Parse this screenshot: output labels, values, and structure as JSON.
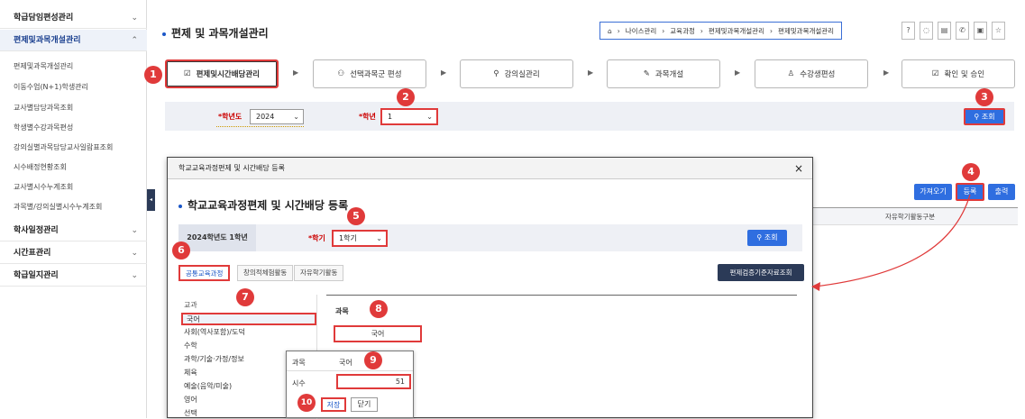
{
  "sidebar": {
    "groups": [
      {
        "label": "학급담임편성관리",
        "open": false
      },
      {
        "label": "편제및과목개설관리",
        "open": true,
        "items": [
          "편제및과목개설관리",
          "이동수업(N+1)학생관리",
          "교사별담당과목조회",
          "학생별수강과목편성",
          "강의실별과목담당교사일람표조회",
          "시수배정현황조회",
          "교사별시수누계조회",
          "과목별/강의실별시수누계조회"
        ]
      },
      {
        "label": "학사일정관리",
        "open": false
      },
      {
        "label": "시간표관리",
        "open": false
      },
      {
        "label": "학급일지관리",
        "open": false
      }
    ]
  },
  "page": {
    "title": "편제 및 과목개설관리",
    "breadcrumb": [
      "나이스관리",
      "교육과정",
      "편제및과목개설관리",
      "편제및과목개설관리"
    ]
  },
  "steps": [
    "편제및시간배당관리",
    "선택과목군 편성",
    "강의실관리",
    "과목개설",
    "수강생편성",
    "확인 및 승인"
  ],
  "filter": {
    "year_label": "*학년도",
    "year": "2024",
    "grade_label": "*학년",
    "grade": "1",
    "search": "조회"
  },
  "actions": {
    "fetch": "가져오기",
    "register": "등록",
    "print": "출력"
  },
  "table": {
    "col": "자유학기활동구분"
  },
  "modal": {
    "header": "학교교육과정편제 및 시간배당 등록",
    "title": "학교교육과정편제 및 시간배당 등록",
    "info": "2024학년도 1학년",
    "term_label": "*학기",
    "term": "1학기",
    "search": "조회",
    "tabs": [
      "공통교육과정",
      "창의적체험활동",
      "자유학기활동"
    ],
    "std_btn": "편제검증기준자료조회",
    "subject_col": "교과",
    "subjects": [
      "국어",
      "사회(역사포함)/도덕",
      "수학",
      "과학/기술·가정/정보",
      "체육",
      "예술(음악/미술)",
      "영어",
      "선택"
    ],
    "course_col": "과목",
    "course": "국어"
  },
  "popup": {
    "course_label": "과목",
    "course": "국어",
    "hours_label": "시수",
    "hours": "51",
    "save": "저장",
    "close": "닫기"
  },
  "badges": [
    "1",
    "2",
    "3",
    "4",
    "5",
    "6",
    "7",
    "8",
    "9",
    "10"
  ]
}
